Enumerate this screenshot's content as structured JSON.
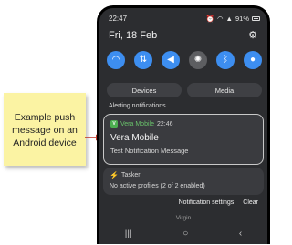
{
  "annotation": {
    "lines": [
      "Example push",
      "message on an",
      "Android device"
    ]
  },
  "status_bar": {
    "time": "22:47",
    "battery": "91%"
  },
  "header": {
    "date": "Fri, 18 Feb"
  },
  "quick_toggles": [
    {
      "icon": "wifi-icon",
      "glyph": "◠",
      "on": true
    },
    {
      "icon": "data-transfer-icon",
      "glyph": "⇅",
      "on": true
    },
    {
      "icon": "sound-icon",
      "glyph": "◀",
      "on": true
    },
    {
      "icon": "brightness-icon",
      "glyph": "✺",
      "on": false
    },
    {
      "icon": "bluetooth-icon",
      "glyph": "ᛒ",
      "on": true
    },
    {
      "icon": "location-icon",
      "glyph": "●",
      "on": true
    }
  ],
  "pills": {
    "devices": "Devices",
    "media": "Media"
  },
  "alerting_label": "Alerting notifications",
  "notification": {
    "app_name": "Vera Mobile",
    "time": "22:46",
    "title": "Vera Mobile",
    "body": "Test Notification Message"
  },
  "tasker": {
    "app_name": "Tasker",
    "body": "No active profiles (2 of 2 enabled)"
  },
  "footer": {
    "settings": "Notification settings",
    "clear": "Clear"
  },
  "carrier": "Virgin",
  "colors": {
    "accent": "#3d8ef0",
    "panel": "#2c2d30",
    "note": "#fbf3a3",
    "arrow": "#c0392b"
  }
}
